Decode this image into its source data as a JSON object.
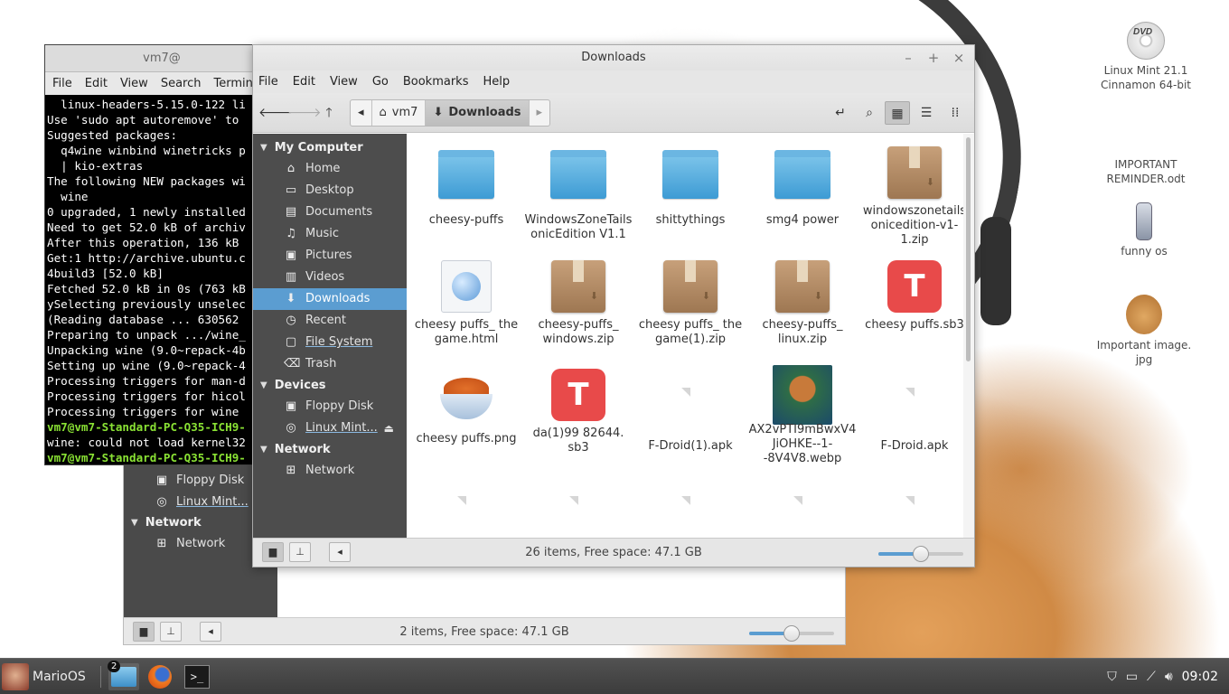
{
  "desktop": {
    "icons": [
      {
        "label": "Linux Mint 21.1 Cinnamon 64-bit",
        "icon": "dvd-icon"
      },
      {
        "label": "IMPORTANT REMINDER.odt",
        "icon": "document-icon"
      },
      {
        "label": "funny os",
        "icon": "phone-icon"
      },
      {
        "label": "Important image. jpg",
        "icon": "dog-image-icon"
      }
    ]
  },
  "terminal": {
    "title": "vm7@",
    "menu": [
      "File",
      "Edit",
      "View",
      "Search",
      "Terminal"
    ],
    "lines": [
      "  linux-headers-5.15.0-122 li",
      "Use 'sudo apt autoremove' to",
      "Suggested packages:",
      "  q4wine winbind winetricks p",
      "  | kio-extras",
      "The following NEW packages wi",
      "  wine",
      "0 upgraded, 1 newly installed",
      "Need to get 52.0 kB of archiv",
      "After this operation, 136 kB ",
      "Get:1 http://archive.ubuntu.c",
      "4build3 [52.0 kB]",
      "Fetched 52.0 kB in 0s (763 kB",
      "ySelecting previously unselec",
      "(Reading database ... 630562 ",
      "Preparing to unpack .../wine_",
      "Unpacking wine (9.0~repack-4b",
      "Setting up wine (9.0~repack-4",
      "Processing triggers for man-d",
      "Processing triggers for hicol",
      "Processing triggers for wine "
    ],
    "prompt1": "vm7@vm7-Standard-PC-Q35-ICH9-",
    "error_line": "wine: could not load kernel32",
    "prompt2": "vm7@vm7-Standard-PC-Q35-ICH9-"
  },
  "background_fm": {
    "items": [
      {
        "label": "Floppy Disk",
        "icon": "floppy-icon"
      },
      {
        "label": "Linux Mint...",
        "icon": "disc-icon"
      }
    ],
    "network_section": "Network",
    "network_item": "Network",
    "status": "2 items, Free space: 47.1 GB",
    "zoom": 0.5
  },
  "file_manager": {
    "title": "Downloads",
    "menu": [
      "File",
      "Edit",
      "View",
      "Go",
      "Bookmarks",
      "Help"
    ],
    "breadcrumbs": [
      "vm7",
      "Downloads"
    ],
    "sidebar": {
      "sections": [
        {
          "title": "My Computer",
          "items": [
            {
              "label": "Home",
              "icon": "home-icon"
            },
            {
              "label": "Desktop",
              "icon": "desktop-icon"
            },
            {
              "label": "Documents",
              "icon": "documents-icon"
            },
            {
              "label": "Music",
              "icon": "music-icon"
            },
            {
              "label": "Pictures",
              "icon": "pictures-icon"
            },
            {
              "label": "Videos",
              "icon": "videos-icon"
            },
            {
              "label": "Downloads",
              "icon": "downloads-icon",
              "selected": true
            },
            {
              "label": "Recent",
              "icon": "recent-icon"
            },
            {
              "label": "File System",
              "icon": "filesystem-icon"
            },
            {
              "label": "Trash",
              "icon": "trash-icon"
            }
          ]
        },
        {
          "title": "Devices",
          "items": [
            {
              "label": "Floppy Disk",
              "icon": "floppy-icon"
            },
            {
              "label": "Linux Mint...",
              "icon": "disc-icon"
            }
          ]
        },
        {
          "title": "Network",
          "items": [
            {
              "label": "Network",
              "icon": "network-icon"
            }
          ]
        }
      ]
    },
    "files": [
      {
        "name": "cheesy-puffs",
        "type": "folder"
      },
      {
        "name": "WindowsZoneTailsonicEdition V1.1",
        "type": "folder"
      },
      {
        "name": "shittythings",
        "type": "folder"
      },
      {
        "name": "smg4 power",
        "type": "folder"
      },
      {
        "name": "windowszonetailsonicedition-v1-1.zip",
        "type": "archive"
      },
      {
        "name": "cheesy puffs_ the game.html",
        "type": "html"
      },
      {
        "name": "cheesy-puffs_ windows.zip",
        "type": "archive"
      },
      {
        "name": "cheesy puffs_ the game(1).zip",
        "type": "archive"
      },
      {
        "name": "cheesy-puffs_ linux.zip",
        "type": "archive"
      },
      {
        "name": "cheesy puffs.sb3",
        "type": "sb3"
      },
      {
        "name": "cheesy puffs.png",
        "type": "png"
      },
      {
        "name": "da(1)99 82644. sb3",
        "type": "sb3"
      },
      {
        "name": "F-Droid(1).apk",
        "type": "apk"
      },
      {
        "name": "AX2vPTI9mBwxV4JiOHKE--1--8V4V8.webp",
        "type": "webp"
      },
      {
        "name": "F-Droid.apk",
        "type": "apk"
      }
    ],
    "status": "26 items, Free space: 47.1 GB",
    "zoom": 0.5
  },
  "taskbar": {
    "menu_label": "MarioOS",
    "badge": "2",
    "clock": "09:02"
  }
}
